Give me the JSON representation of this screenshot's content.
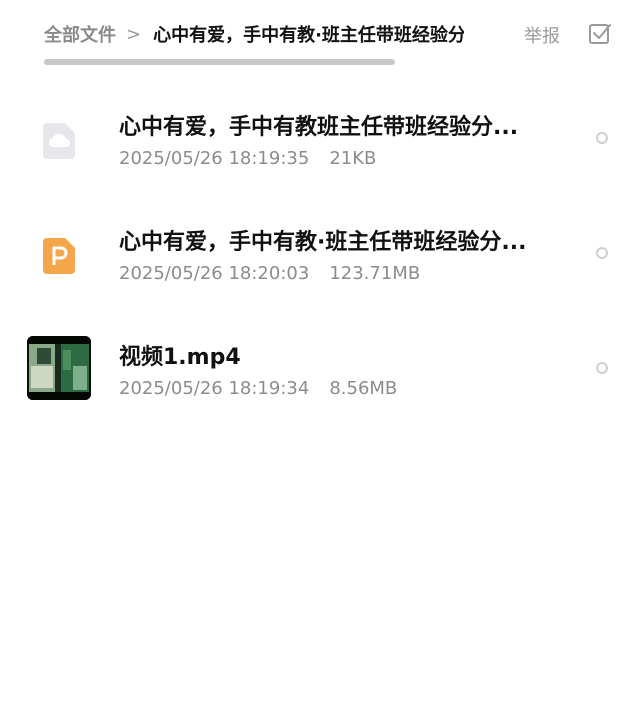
{
  "header": {
    "breadcrumb_root": "全部文件",
    "breadcrumb_separator": ">",
    "breadcrumb_current": "心中有爱，手中有教·班主任带班经验分享",
    "report_label": "举报"
  },
  "colors": {
    "ppt_icon": "#f5a54a",
    "cloud_icon": "#e6e7ea",
    "meta_text": "#8c8c8c"
  },
  "files": [
    {
      "name": "心中有爱，手中有教班主任带班经验分...",
      "date": "2025/05/26 18:19:35",
      "size": "21KB",
      "icon": "cloud-file-icon"
    },
    {
      "name": "心中有爱，手中有教·班主任带班经验分...",
      "date": "2025/05/26 18:20:03",
      "size": "123.71MB",
      "icon": "ppt-file-icon"
    },
    {
      "name": "视频1.mp4",
      "date": "2025/05/26 18:19:34",
      "size": "8.56MB",
      "icon": "video-thumbnail"
    }
  ]
}
